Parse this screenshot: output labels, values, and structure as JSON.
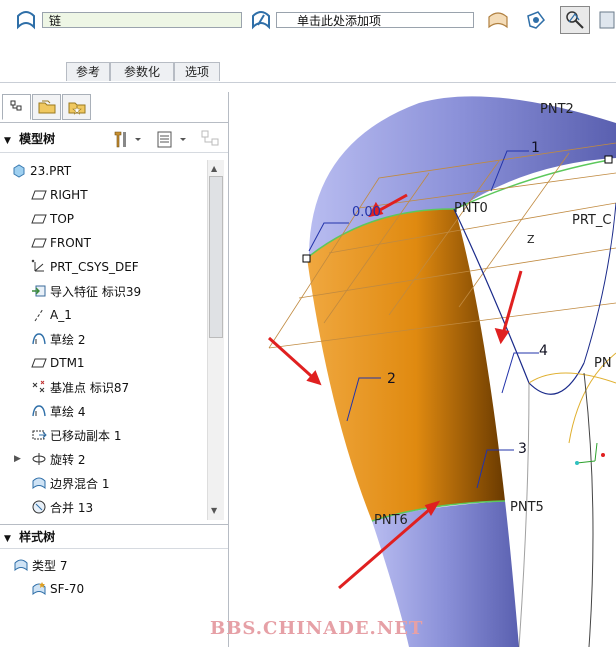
{
  "dashboard": {
    "chain_value": "链",
    "collector_placeholder": "单击此处添加项",
    "tabs": [
      "参考",
      "参数化",
      "选项"
    ]
  },
  "model_tree": {
    "title": "模型树",
    "items": [
      {
        "label": "23.PRT",
        "icon": "part-icon"
      },
      {
        "label": "RIGHT",
        "icon": "datum-plane-icon"
      },
      {
        "label": "TOP",
        "icon": "datum-plane-icon"
      },
      {
        "label": "FRONT",
        "icon": "datum-plane-icon"
      },
      {
        "label": "PRT_CSYS_DEF",
        "icon": "csys-icon"
      },
      {
        "label": "导入特征 标识39",
        "icon": "import-feature-icon"
      },
      {
        "label": "A_1",
        "icon": "datum-axis-icon"
      },
      {
        "label": "草绘 2",
        "icon": "sketch-icon"
      },
      {
        "label": "DTM1",
        "icon": "datum-plane-icon"
      },
      {
        "label": "基准点 标识87",
        "icon": "datum-point-icon"
      },
      {
        "label": "草绘 4",
        "icon": "sketch-icon"
      },
      {
        "label": "已移动副本 1",
        "icon": "moved-copy-icon"
      },
      {
        "label": "旋转 2",
        "icon": "revolve-icon"
      },
      {
        "label": "边界混合 1",
        "icon": "boundary-blend-icon"
      },
      {
        "label": "合并 13",
        "icon": "merge-icon"
      }
    ]
  },
  "style_tree": {
    "title": "样式树",
    "items": [
      {
        "label": "类型 7"
      },
      {
        "label": "SF-70"
      }
    ]
  },
  "graphics": {
    "tension_value": "0.00",
    "point_labels": [
      "PNT2",
      "PNT0",
      "PRT_C",
      "PNT6",
      "PNT5",
      "PN"
    ],
    "axis_label": "Z",
    "chain_numbers": [
      "1",
      "2",
      "3",
      "4"
    ],
    "watermark": "BBS.CHINADE.NET"
  },
  "colors": {
    "surface_blue": "#8a90d8",
    "surface_orange": "#e08a10",
    "annotation_red": "#e02020",
    "watermark": "#e6a0a6"
  }
}
